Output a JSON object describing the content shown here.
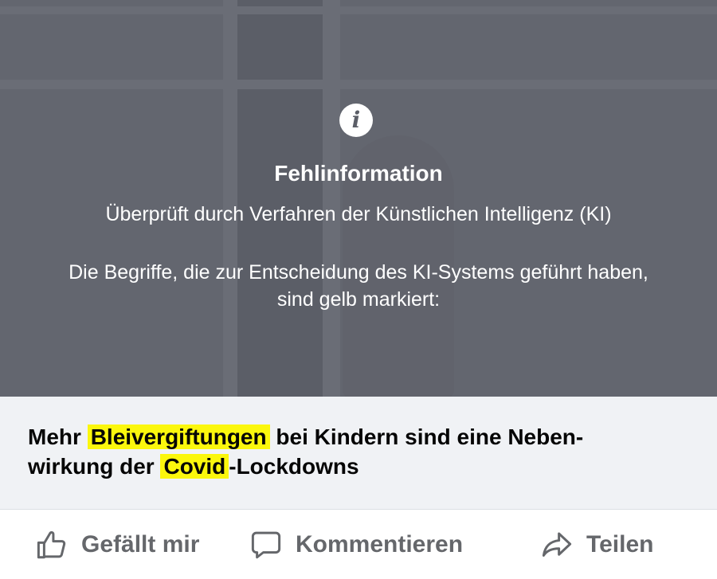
{
  "overlay": {
    "icon": "info-icon",
    "title": "Fehlinformation",
    "subtitle": "Überprüft durch Verfahren der Künstlichen Intelligenz (KI)",
    "explanation_line1": "Die Begriffe, die zur Entscheidung des KI-Systems geführt haben,",
    "explanation_line2": "sind gelb markiert:"
  },
  "headline": {
    "part1": "Mehr ",
    "highlight1": "Bleivergiftungen",
    "part2": " bei Kindern sind eine Neben-",
    "part3": "wirkung der ",
    "highlight2": "Covid",
    "part4": "-Lockdowns",
    "highlight_color": "#fbf70d"
  },
  "actions": {
    "like_label": "Gefällt mir",
    "like_icon": "thumbs-up-icon",
    "comment_label": "Kommentieren",
    "comment_icon": "comment-icon",
    "share_label": "Teilen",
    "share_icon": "share-icon"
  }
}
